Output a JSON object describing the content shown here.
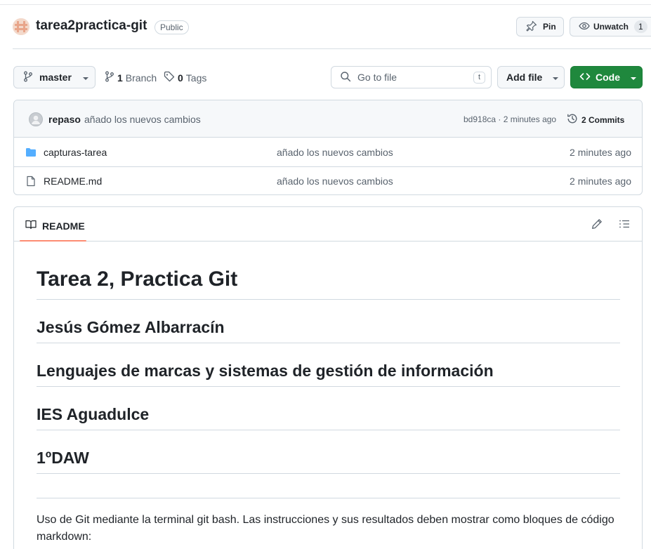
{
  "repo": {
    "name": "tarea2practica-git",
    "visibility": "Public",
    "pin_label": "Pin",
    "watch_label": "Unwatch",
    "watch_count": "1"
  },
  "toolbar": {
    "branch": "master",
    "branch_count": "1",
    "branch_label": "Branch",
    "tag_count": "0",
    "tag_label": "Tags",
    "search_placeholder": "Go to file",
    "search_shortcut": "t",
    "add_file_label": "Add file",
    "code_label": "Code"
  },
  "commit": {
    "author": "repaso",
    "message": "añado los nuevos cambios",
    "hash_time": "bd918ca · 2 minutes ago",
    "commits_label": "2 Commits"
  },
  "files": [
    {
      "name": "capturas-tarea",
      "type": "folder",
      "message": "añado los nuevos cambios",
      "time": "2 minutes ago"
    },
    {
      "name": "README.md",
      "type": "file",
      "message": "añado los nuevos cambios",
      "time": "2 minutes ago"
    }
  ],
  "readme": {
    "tab_label": "README",
    "h1": "Tarea 2, Practica Git",
    "headings": [
      "Jesús Gómez Albarracín",
      "Lenguajes de marcas y sistemas de gestión de información",
      "IES Aguadulce",
      "1ºDAW"
    ],
    "paragraph": "Uso de Git mediante la terminal git bash. Las instrucciones y sus resultados deben mostrar como bloques de código markdown:"
  },
  "colors": {
    "accent_green": "#1f883d",
    "tab_underline": "#fd8c73",
    "folder_blue": "#54aeff"
  }
}
